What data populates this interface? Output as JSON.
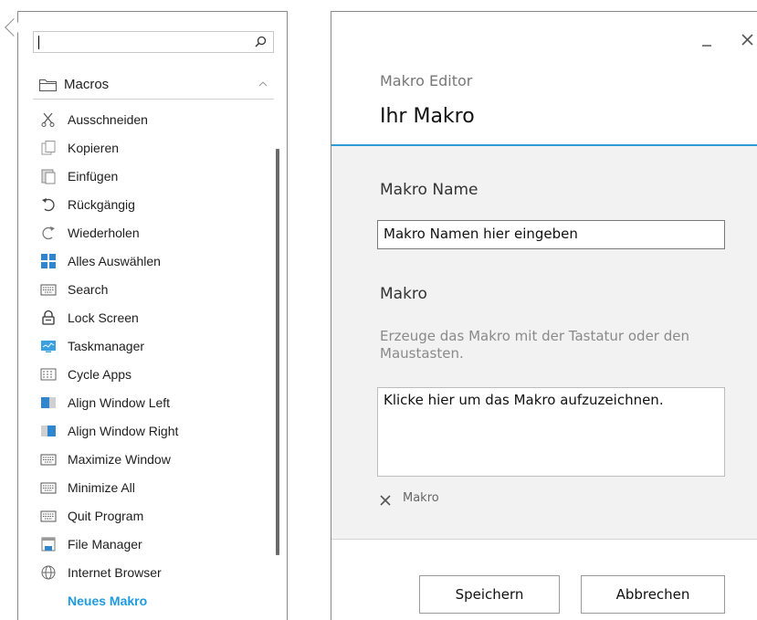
{
  "macro_list": {
    "search": {
      "value": "",
      "placeholder": ""
    },
    "header": {
      "label": "Macros"
    },
    "items": [
      {
        "label": "Ausschneiden",
        "icon": "scissors-icon"
      },
      {
        "label": "Kopieren",
        "icon": "copy-icon"
      },
      {
        "label": "Einfügen",
        "icon": "paste-icon"
      },
      {
        "label": "Rückgängig",
        "icon": "undo-icon"
      },
      {
        "label": "Wiederholen",
        "icon": "redo-icon"
      },
      {
        "label": "Alles Auswählen",
        "icon": "select-all-icon"
      },
      {
        "label": "Search",
        "icon": "keyboard-icon"
      },
      {
        "label": "Lock Screen",
        "icon": "lock-icon"
      },
      {
        "label": "Taskmanager",
        "icon": "monitor-icon"
      },
      {
        "label": "Cycle Apps",
        "icon": "apps-grid-icon"
      },
      {
        "label": "Align Window Left",
        "icon": "window-left-icon"
      },
      {
        "label": "Align Window Right",
        "icon": "window-right-icon"
      },
      {
        "label": "Maximize Window",
        "icon": "keyboard-icon"
      },
      {
        "label": "Minimize All",
        "icon": "keyboard-icon"
      },
      {
        "label": "Quit Program",
        "icon": "keyboard-icon"
      },
      {
        "label": "File Manager",
        "icon": "file-manager-icon"
      },
      {
        "label": "Internet Browser",
        "icon": "globe-icon"
      }
    ],
    "new_macro_label": "Neues Makro"
  },
  "editor": {
    "subtitle": "Makro Editor",
    "title": "Ihr Makro",
    "name_label": "Makro Name",
    "name_value": "Makro Namen hier eingeben",
    "macro_label": "Makro",
    "hint": "Erzeuge das Makro mit der Tastatur oder den Maustasten.",
    "record_prompt": "Klicke hier um das Makro aufzuzeichnen.",
    "chip_label": "Makro",
    "save_label": "Speichern",
    "cancel_label": "Abbrechen"
  },
  "colors": {
    "accent": "#2f9bd4",
    "link": "#1e9be0",
    "body_bg": "#f2f2f2"
  }
}
